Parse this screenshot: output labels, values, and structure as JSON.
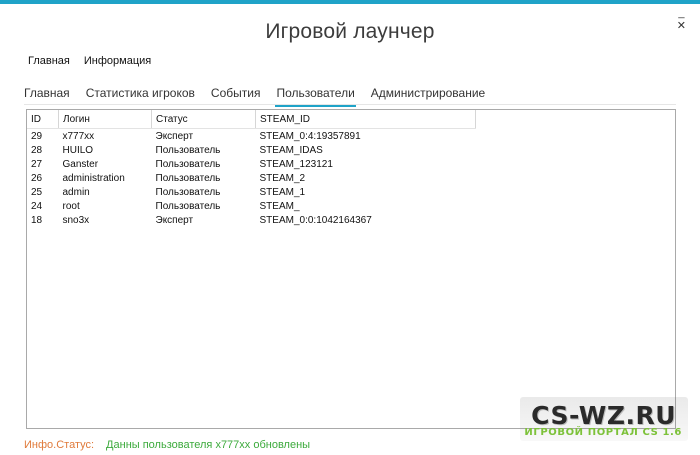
{
  "window": {
    "title": "Игровой лаунчер",
    "minimize": "_",
    "close": "✕"
  },
  "menu": [
    "Главная",
    "Информация"
  ],
  "tabs": [
    {
      "label": "Главная"
    },
    {
      "label": "Статистика игроков"
    },
    {
      "label": "События"
    },
    {
      "label": "Пользователи",
      "active": true
    },
    {
      "label": "Администрирование"
    }
  ],
  "table": {
    "headers": [
      "ID",
      "Логин",
      "Статус",
      "STEAM_ID"
    ],
    "rows": [
      [
        "29",
        "x777xx",
        "Эксперт",
        "STEAM_0:4:19357891"
      ],
      [
        "28",
        "HUILO",
        "Пользователь",
        "STEAM_IDAS"
      ],
      [
        "27",
        "Ganster",
        "Пользователь",
        "STEAM_123121"
      ],
      [
        "26",
        "administration",
        "Пользователь",
        "STEAM_2"
      ],
      [
        "25",
        "admin",
        "Пользователь",
        "STEAM_1"
      ],
      [
        "24",
        "root",
        "Пользователь",
        "STEAM_"
      ],
      [
        "18",
        "sno3x",
        "Эксперт",
        "STEAM_0:0:1042164367"
      ]
    ]
  },
  "status": {
    "label": "Инфо.Статус:",
    "message": "Данны пользователя x777xx обновлены"
  },
  "watermark": {
    "main": "CS-WZ.RU",
    "sub": "ИГРОВОЙ ПОРТАЛ CS 1.6"
  },
  "colors": {
    "accent": "#1fa3c8",
    "status_label": "#e07a3a",
    "status_message": "#3caa3c",
    "watermark_sub": "#7dc23a"
  }
}
